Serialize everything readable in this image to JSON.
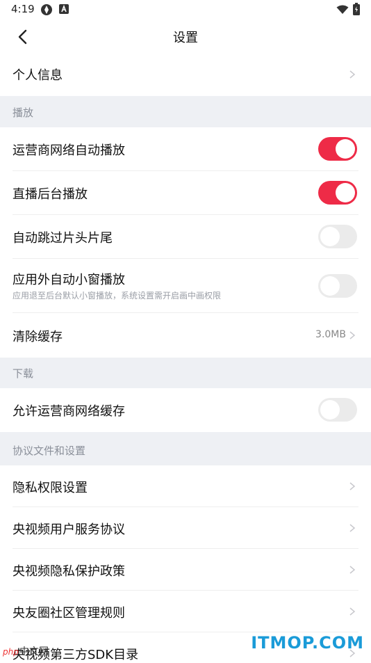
{
  "status_bar": {
    "time": "4:19"
  },
  "header": {
    "title": "设置"
  },
  "rows": {
    "personal_info": "个人信息",
    "carrier_autoplay": "运营商网络自动播放",
    "background_play": "直播后台播放",
    "skip_intro": "自动跳过片头片尾",
    "pip_play": "应用外自动小窗播放",
    "pip_desc": "应用退至后台默认小窗播放，系统设置需开启画中画权限",
    "clear_cache": "清除缓存",
    "cache_size": "3.0MB",
    "allow_carrier_cache": "允许运营商网络缓存",
    "privacy_permissions": "隐私权限设置",
    "service_agreement": "央视频用户服务协议",
    "privacy_policy": "央视频隐私保护政策",
    "community_rules": "央友圈社区管理规则",
    "sdk_list": "央视频第三方SDK目录"
  },
  "sections": {
    "playback": "播放",
    "download": "下载",
    "agreements": "协议文件和设置"
  },
  "toggles": {
    "carrier_autoplay": true,
    "background_play": true,
    "skip_intro": false,
    "pip_play": false,
    "allow_carrier_cache": false
  },
  "colors": {
    "accent": "#ee2b47",
    "section_bg": "#eef0f4",
    "watermark": "#1a9bd8"
  },
  "watermark": {
    "site": "ITMOP.COM",
    "php_badge": "php",
    "php_text": "中文网"
  }
}
